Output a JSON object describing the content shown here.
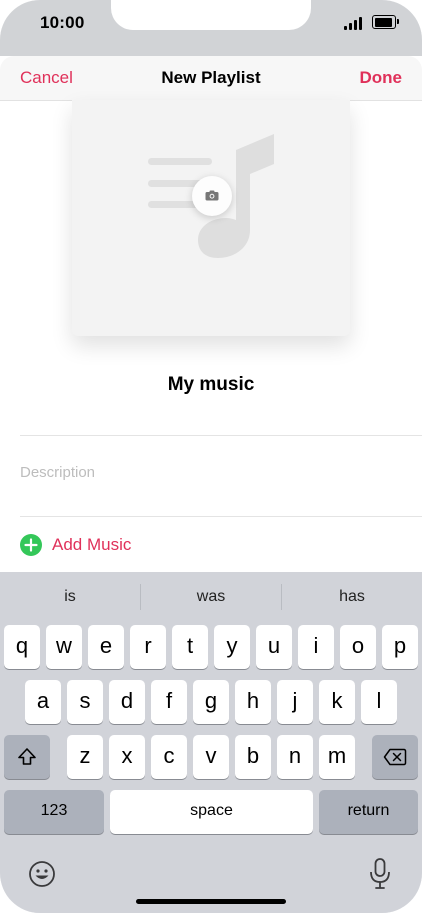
{
  "status": {
    "time": "10:00"
  },
  "nav": {
    "cancel": "Cancel",
    "title": "New Playlist",
    "done": "Done"
  },
  "playlist": {
    "name": "My music",
    "description_placeholder": "Description",
    "add_music": "Add Music"
  },
  "keyboard": {
    "suggestions": [
      "is",
      "was",
      "has"
    ],
    "row1": [
      "q",
      "w",
      "e",
      "r",
      "t",
      "y",
      "u",
      "i",
      "o",
      "p"
    ],
    "row2": [
      "a",
      "s",
      "d",
      "f",
      "g",
      "h",
      "j",
      "k",
      "l"
    ],
    "row3": [
      "z",
      "x",
      "c",
      "v",
      "b",
      "n",
      "m"
    ],
    "numbers": "123",
    "space": "space",
    "return": "return"
  },
  "colors": {
    "accent": "#e0315a",
    "add_green": "#34c759",
    "keyboard_bg": "#d1d3d9"
  }
}
